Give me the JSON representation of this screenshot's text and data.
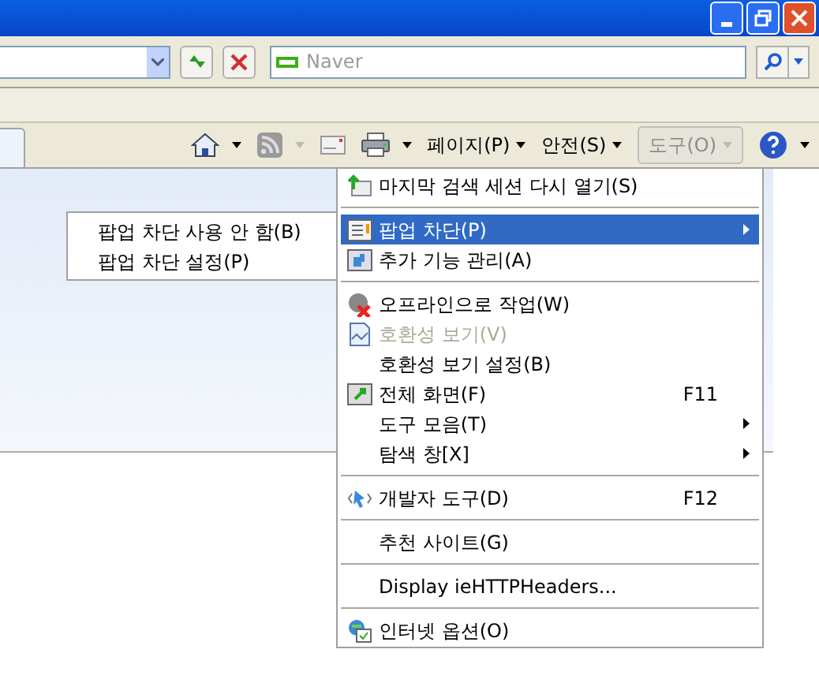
{
  "search": {
    "placeholder": "Naver"
  },
  "toolbar": [
    {
      "kind": "home",
      "caret": true
    },
    {
      "kind": "feed",
      "caret": true,
      "disabled": true
    },
    {
      "kind": "mail",
      "caret": false
    },
    {
      "kind": "print",
      "caret": true
    },
    {
      "kind": "text",
      "label": "페이지(P)",
      "selected": false
    },
    {
      "kind": "text",
      "label": "안전(S)",
      "selected": false
    },
    {
      "kind": "text",
      "label": "도구(O)",
      "selected": true
    },
    {
      "kind": "help",
      "caret": true
    }
  ],
  "menu": [
    {
      "kind": "item",
      "label": "마지막 검색 세션 다시 열기(S)",
      "selected": false,
      "disabled": false
    },
    {
      "kind": "separator"
    },
    {
      "kind": "item",
      "label": "팝업 차단(P)",
      "submenu": true,
      "selected": true,
      "disabled": false
    },
    {
      "kind": "item",
      "label": "추가 기능 관리(A)",
      "selected": false,
      "disabled": false
    },
    {
      "kind": "separator"
    },
    {
      "kind": "item",
      "label": "오프라인으로 작업(W)",
      "selected": false,
      "disabled": false
    },
    {
      "kind": "item",
      "label": "호환성 보기(V)",
      "selected": false,
      "disabled": true
    },
    {
      "kind": "item",
      "label": "호환성 보기 설정(B)",
      "selected": false,
      "disabled": false
    },
    {
      "kind": "item",
      "label": "전체 화면(F)",
      "shortcut": "F11",
      "selected": false,
      "disabled": false
    },
    {
      "kind": "item",
      "label": "도구 모음(T)",
      "submenu": true,
      "selected": false,
      "disabled": false
    },
    {
      "kind": "item",
      "label": "탐색 창[X]",
      "submenu": true,
      "selected": false,
      "disabled": false
    },
    {
      "kind": "separator"
    },
    {
      "kind": "item",
      "label": "개발자 도구(D)",
      "shortcut": "F12",
      "selected": false,
      "disabled": false
    },
    {
      "kind": "separator"
    },
    {
      "kind": "item",
      "label": "추천 사이트(G)",
      "selected": false,
      "disabled": false
    },
    {
      "kind": "separator"
    },
    {
      "kind": "item",
      "label": "Display ieHTTPHeaders...",
      "selected": false,
      "disabled": false
    },
    {
      "kind": "separator"
    },
    {
      "kind": "item",
      "label": "인터넷 옵션(O)",
      "selected": false,
      "disabled": false
    }
  ],
  "submenu": [
    {
      "label": "팝업 차단 사용 안 함(B)"
    },
    {
      "label": "팝업 차단 설정(P)"
    }
  ]
}
